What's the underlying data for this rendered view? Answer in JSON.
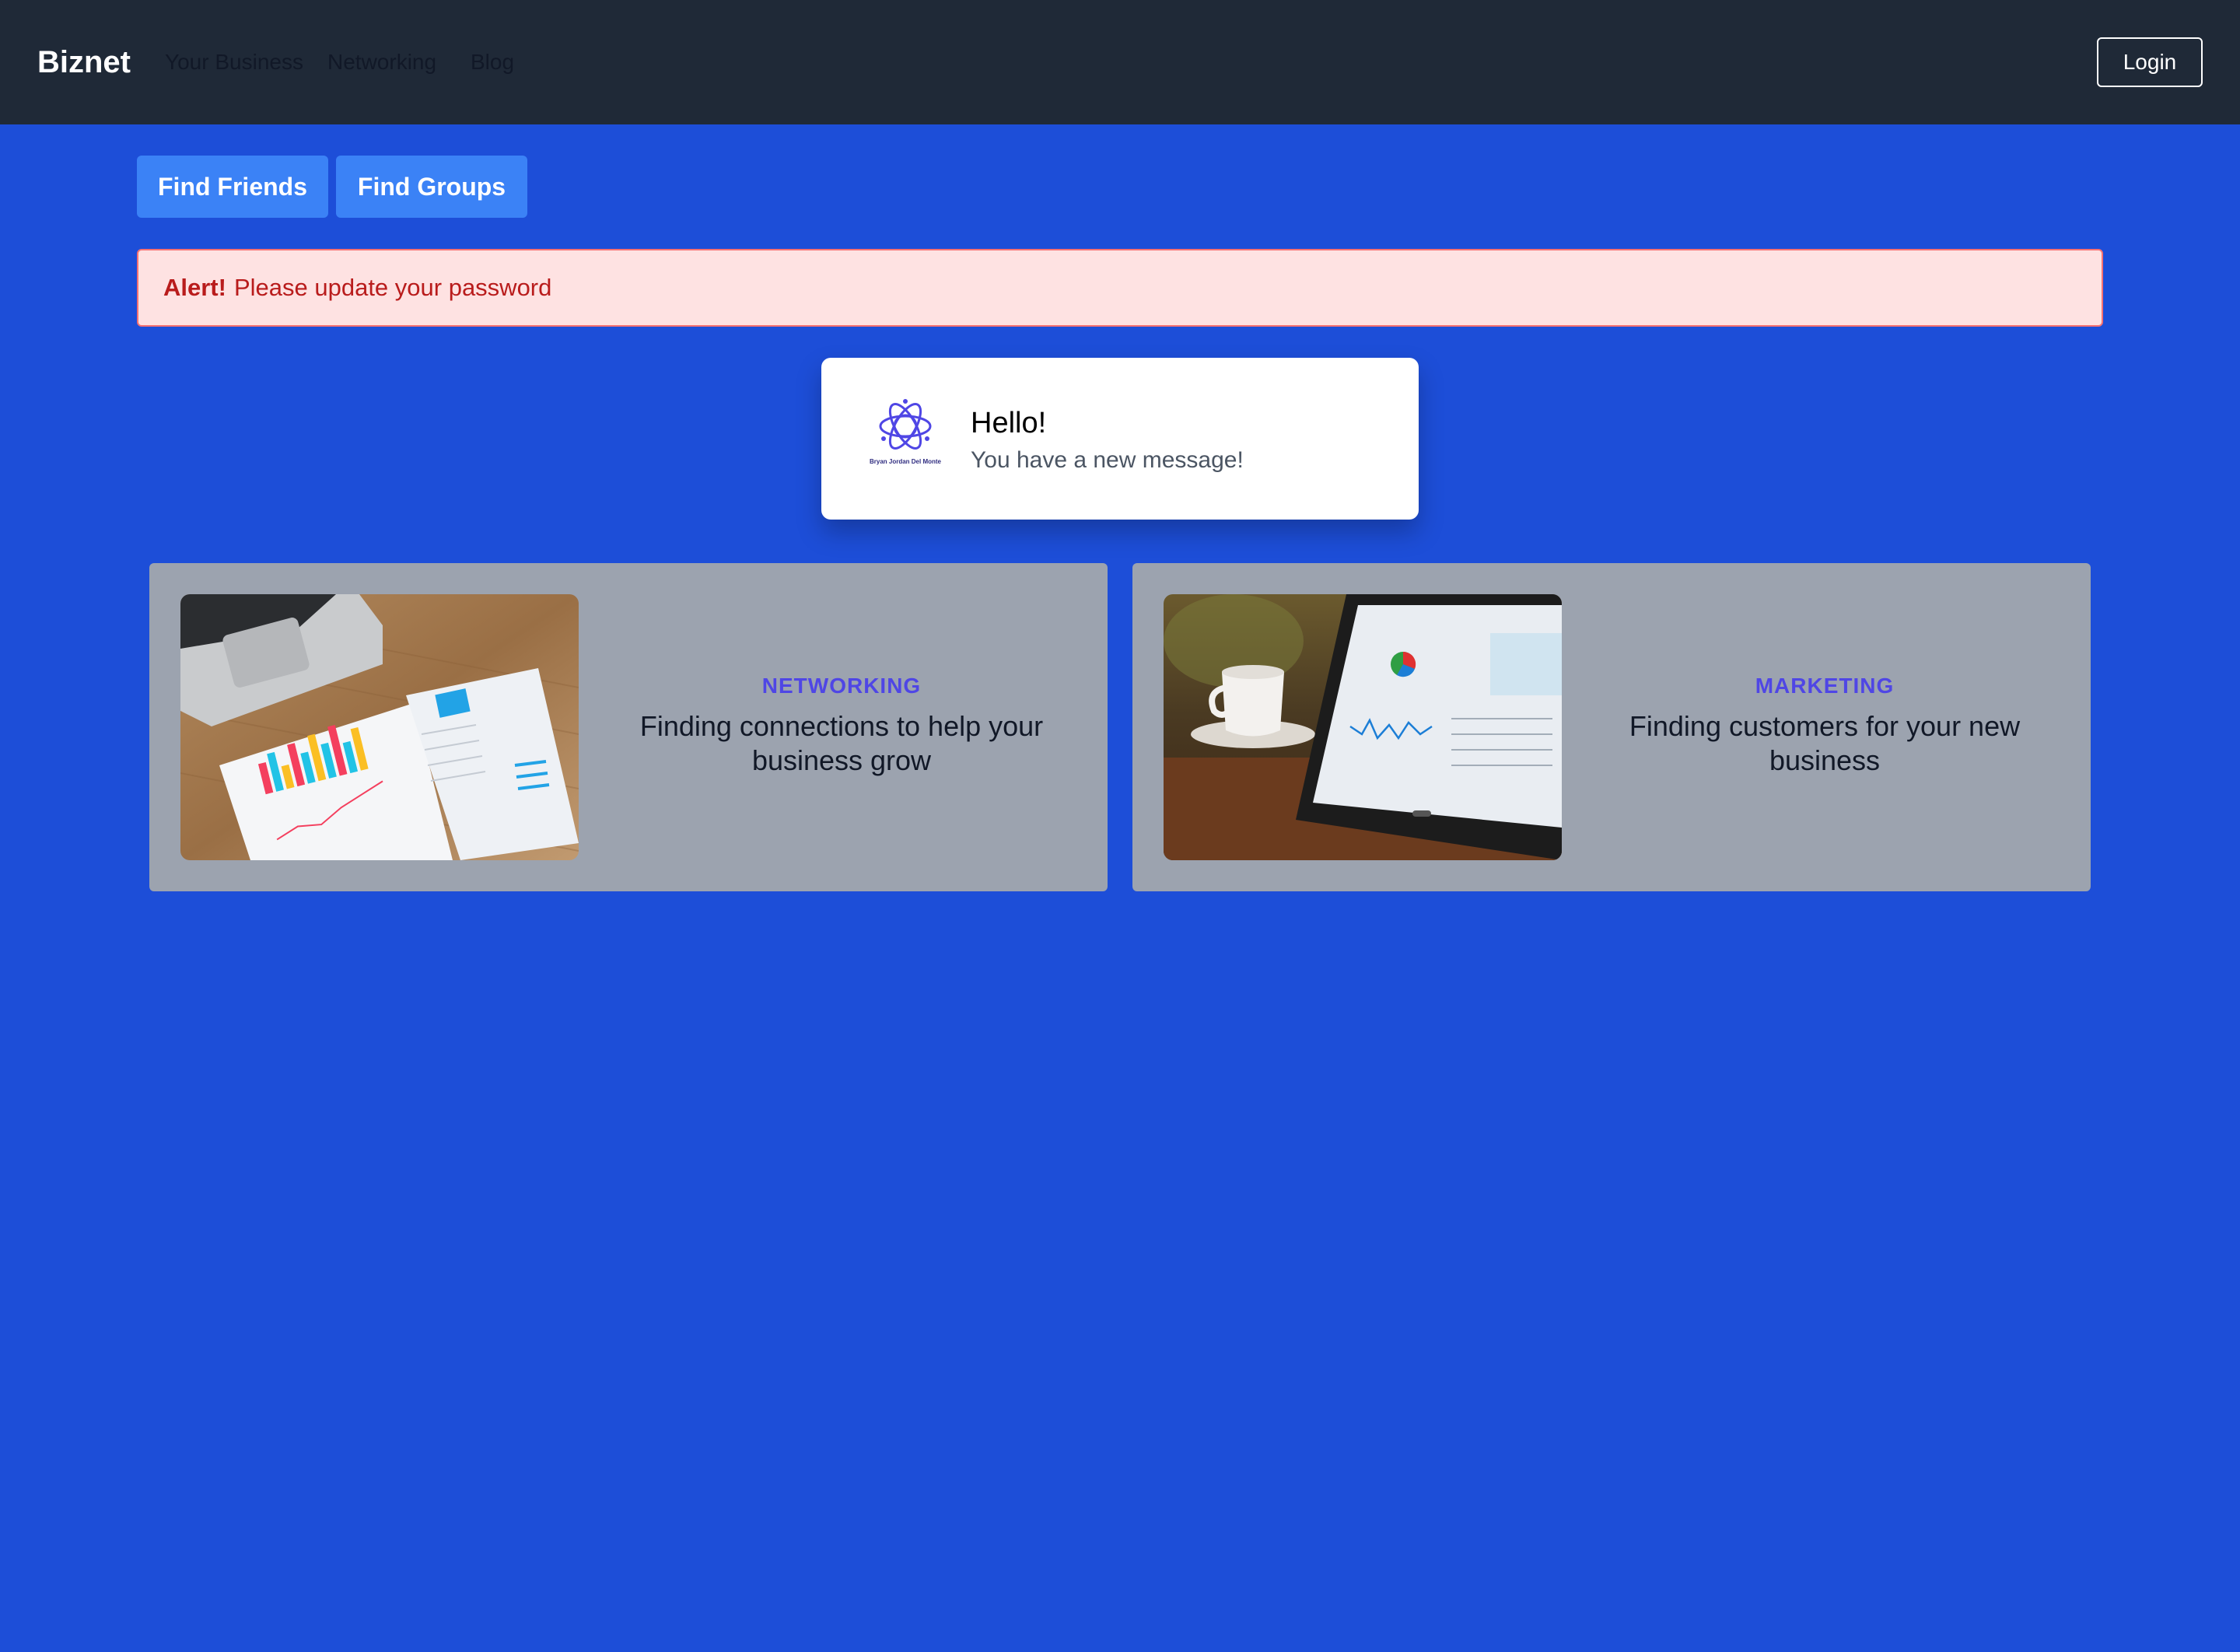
{
  "navbar": {
    "brand": "Biznet",
    "links": [
      "Your Business",
      "Networking",
      "Blog"
    ],
    "login_label": "Login"
  },
  "actions": {
    "find_friends": "Find Friends",
    "find_groups": "Find Groups"
  },
  "alert": {
    "strong": "Alert!",
    "message": "Please update your password"
  },
  "notification": {
    "logo_text": "Bryan Jordan Del Monte",
    "title": "Hello!",
    "message": "You have a new message!"
  },
  "cards": [
    {
      "category": "NETWORKING",
      "description": "Finding connections to help your business grow",
      "image": "analytics-papers-laptop"
    },
    {
      "category": "MARKETING",
      "description": "Finding customers for your new business",
      "image": "tablet-dashboard-coffee"
    }
  ],
  "colors": {
    "page_bg": "#1d4ed8",
    "navbar_bg": "#1f2937",
    "button_bg": "#3b82f6",
    "alert_bg": "#fee2e2",
    "alert_text": "#b91c1c",
    "card_bg": "#9ca3af",
    "category_text": "#4f46e5"
  }
}
